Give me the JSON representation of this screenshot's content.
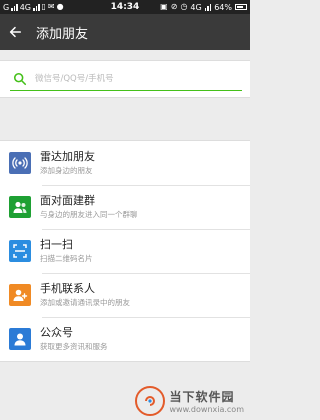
{
  "status_bar": {
    "carrier_left": "G",
    "network_left": "4G",
    "time": "14:34",
    "network_right": "4G",
    "battery": "64%"
  },
  "header": {
    "back_icon": "arrow-left-icon",
    "title": "添加朋友"
  },
  "search": {
    "icon": "search-icon",
    "placeholder": "微信号/QQ号/手机号",
    "value": ""
  },
  "options": [
    {
      "title": "雷达加朋友",
      "subtitle": "添加身边的朋友",
      "icon": "radar-icon",
      "color": "#4a6fb5"
    },
    {
      "title": "面对面建群",
      "subtitle": "与身边的朋友进入同一个群聊",
      "icon": "group-icon",
      "color": "#1ea033"
    },
    {
      "title": "扫一扫",
      "subtitle": "扫描二维码名片",
      "icon": "scan-icon",
      "color": "#2b8de0"
    },
    {
      "title": "手机联系人",
      "subtitle": "添加或邀请通讯录中的朋友",
      "icon": "contacts-icon",
      "color": "#f08a24"
    },
    {
      "title": "公众号",
      "subtitle": "获取更多资讯和服务",
      "icon": "official-account-icon",
      "color": "#2b7bd6"
    }
  ],
  "colors": {
    "accent": "#45c01a",
    "titlebar": "#3a3a3a",
    "background": "#ececec"
  },
  "watermark": {
    "name": "当下软件园",
    "url": "www.downxia.com"
  }
}
